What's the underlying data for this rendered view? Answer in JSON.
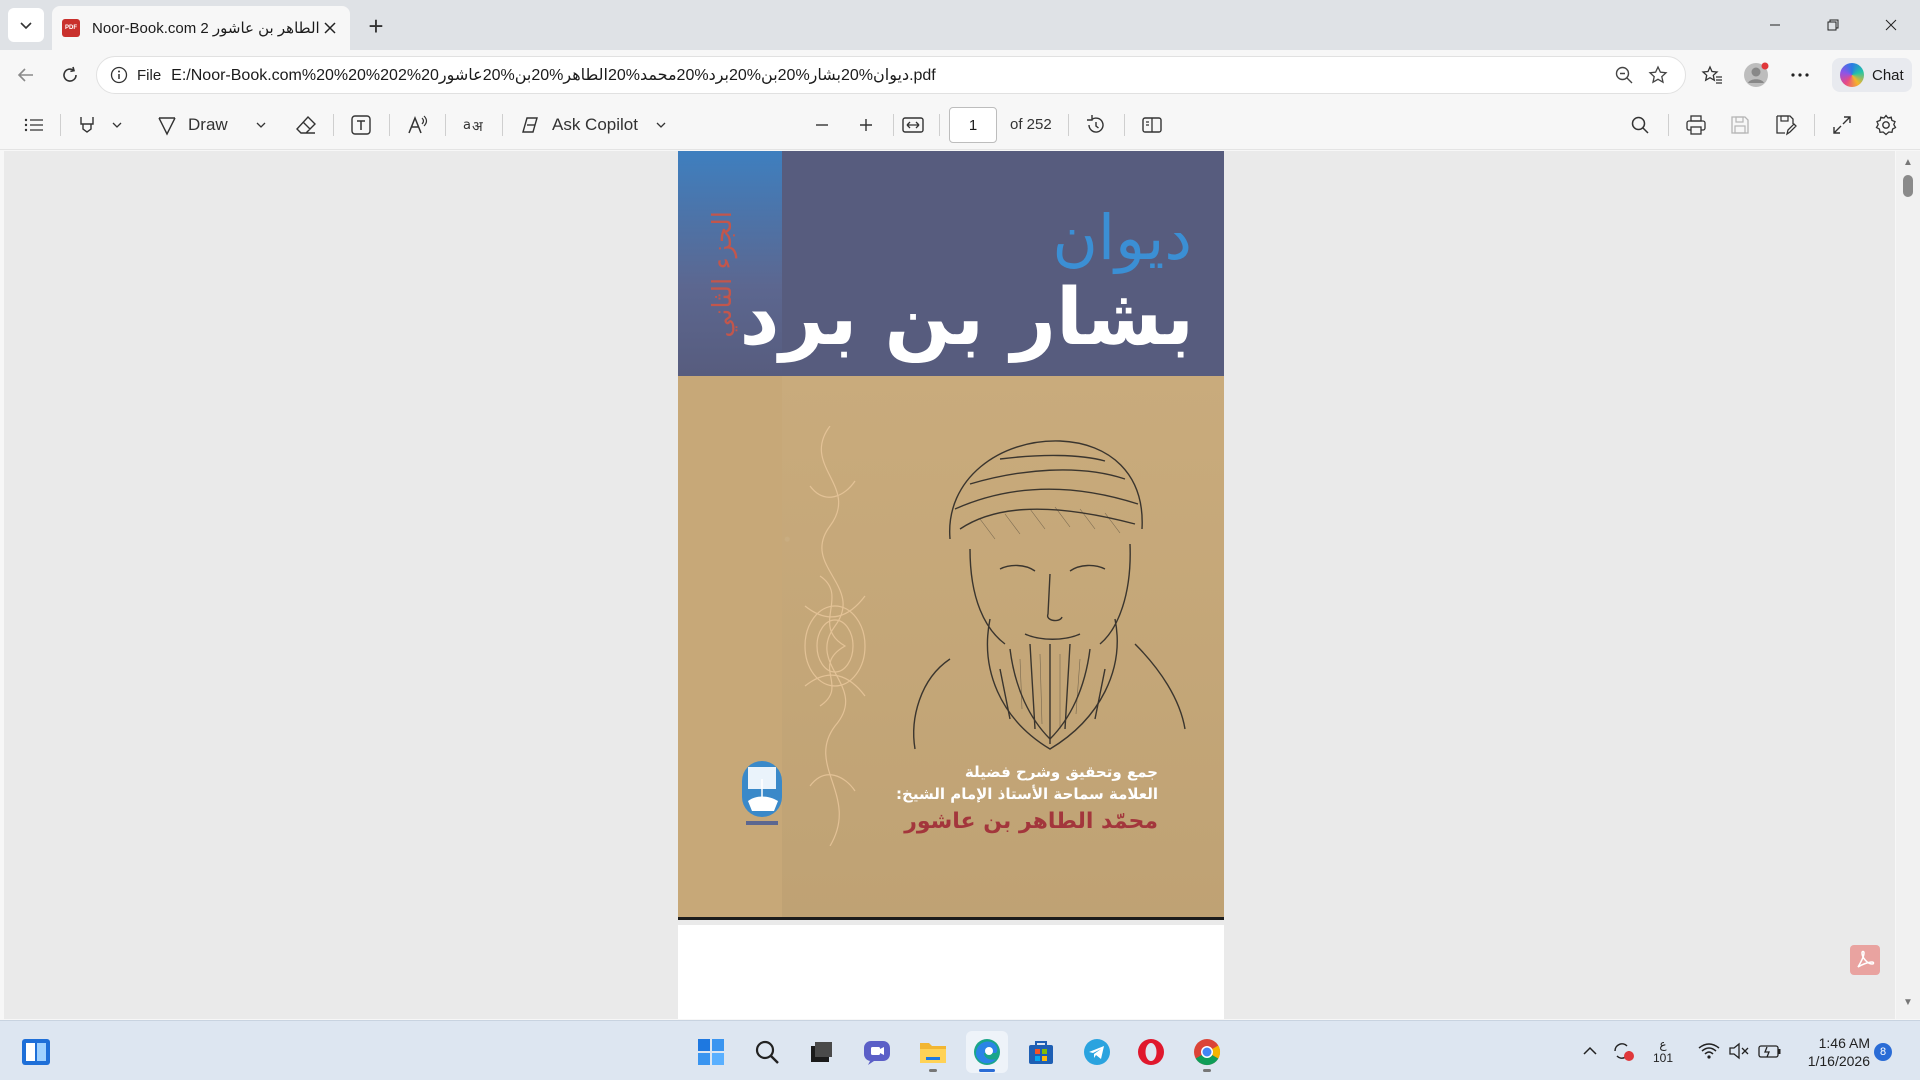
{
  "browser": {
    "tab": {
      "title": "Noor-Book.com الطاهر بن عاشور 2",
      "favicon_badge": "PDF"
    },
    "new_tab_symbol": "+",
    "address": {
      "scheme": "File",
      "url": "E:/Noor-Book.com%20%20%202%20ديوان%20بشار%20بن%20برد%20محمد%20الطاهر%20بن%20عاشور.pdf"
    },
    "chat_label": "Chat"
  },
  "pdf_toolbar": {
    "draw_label": "Draw",
    "ask_copilot_label": "Ask Copilot",
    "current_page": "1",
    "page_total": "of 252"
  },
  "cover": {
    "diwan": "ديوان",
    "poet": "بشار بن برد",
    "volume": "الجزء الثاني",
    "credit_line1": "جمع وتحقيق وشرح فضيلة",
    "credit_line2": "العلامة سماحة الأستاذ الإمام الشيخ:",
    "author": "محمّد الطاهر بن عاشور"
  },
  "taskbar": {
    "tray_lang_top": "ع",
    "tray_lang_bottom": "101",
    "time": "1:46 AM",
    "date": "1/16/2026",
    "notification_count": "8"
  },
  "colors": {
    "cover_blue_panel": "#575c7e",
    "cover_tan": "#c4a77a",
    "diwan_blue": "#3b8fd4",
    "author_red": "#a3363c",
    "accent_blue": "#2a6cd6"
  },
  "icons": [
    "tab-list-icon",
    "pdf-file-icon",
    "close-icon",
    "back-icon",
    "refresh-icon",
    "info-icon",
    "zoom-out-icon",
    "star-icon",
    "favorites-icon",
    "profile-icon",
    "more-icon",
    "copilot-icon",
    "contents-icon",
    "highlight-icon",
    "draw-icon",
    "eraser-icon",
    "text-box-icon",
    "read-aloud-icon",
    "translate-icon",
    "zoom-in-icon",
    "fit-width-icon",
    "rotate-icon",
    "page-view-icon",
    "search-icon",
    "print-icon",
    "save-icon",
    "save-as-icon",
    "fullscreen-icon",
    "settings-icon",
    "start-icon",
    "taskbar-search-icon",
    "task-view-icon",
    "teams-icon",
    "file-explorer-icon",
    "edge-icon",
    "store-icon",
    "telegram-icon",
    "opera-icon",
    "chrome-icon",
    "wifi-icon",
    "mute-icon",
    "battery-icon"
  ]
}
